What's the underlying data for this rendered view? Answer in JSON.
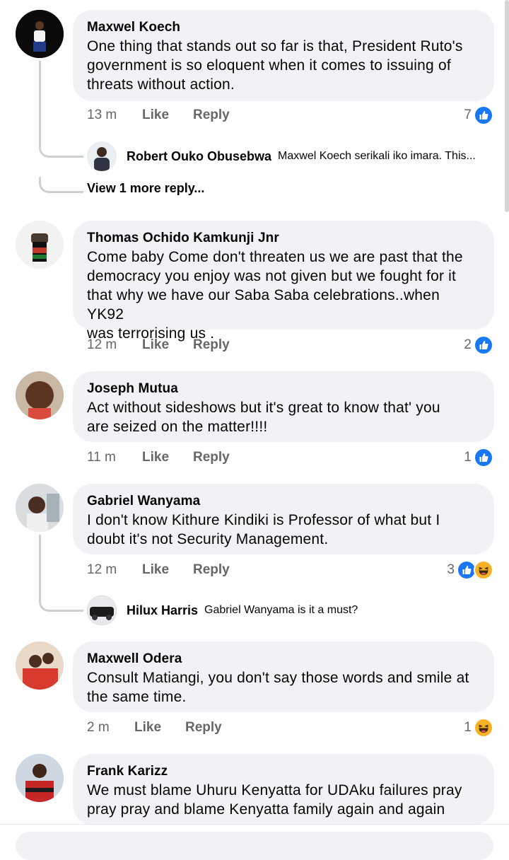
{
  "comments": [
    {
      "author": "Maxwel Koech",
      "text": "One thing that stands out so far is that, President Ruto's\ngovernment is so eloquent when it comes to issuing of\nthreats without action.",
      "time": "13 m",
      "like": "Like",
      "reply": "Reply",
      "reaction_count": "7",
      "reactions": [
        "like-icon"
      ],
      "reply_preview": {
        "author": "Robert Ouko Obusebwa",
        "text": "Maxwel Koech serikali iko imara. This..."
      },
      "view_more": "View 1 more reply..."
    },
    {
      "author": "Thomas Ochido Kamkunji Jnr",
      "text": "Come baby Come don't threaten us we are past that the\ndemocracy you enjoy was not given but we fought for it\nthat why we have our Saba Saba celebrations..when YK92\nwas terrorising us .",
      "time": "12 m",
      "like": "Like",
      "reply": "Reply",
      "reaction_count": "2",
      "reactions": [
        "like-icon"
      ]
    },
    {
      "author": "Joseph Mutua",
      "text": "Act without sideshows but it's great to know that' you\nare seized on the matter!!!!",
      "time": "11 m",
      "like": "Like",
      "reply": "Reply",
      "reaction_count": "1",
      "reactions": [
        "like-icon"
      ]
    },
    {
      "author": "Gabriel Wanyama",
      "text": "I don't know Kithure Kindiki is Professor of what but I\ndoubt it's not Security Management.",
      "time": "12 m",
      "like": "Like",
      "reply": "Reply",
      "reaction_count": "3",
      "reactions": [
        "like-icon",
        "haha-icon"
      ],
      "reply_preview": {
        "author": "Hilux Harris",
        "text": "Gabriel Wanyama is it a must?"
      }
    },
    {
      "author": "Maxwell Odera",
      "text": "Consult Matiangi, you don't say those words and smile at\nthe same time.",
      "time": "2 m",
      "like": "Like",
      "reply": "Reply",
      "reaction_count": "1",
      "reactions": [
        "haha-icon"
      ]
    },
    {
      "author": "Frank Karizz",
      "text": "We must blame Uhuru Kenyatta for UDAku failures pray\npray pray and blame Kenyatta family again and again"
    }
  ],
  "colors": {
    "like": "#1877f2",
    "haha": "#f7b125",
    "bubble": "#f0f2f5",
    "meta": "#65676b"
  }
}
